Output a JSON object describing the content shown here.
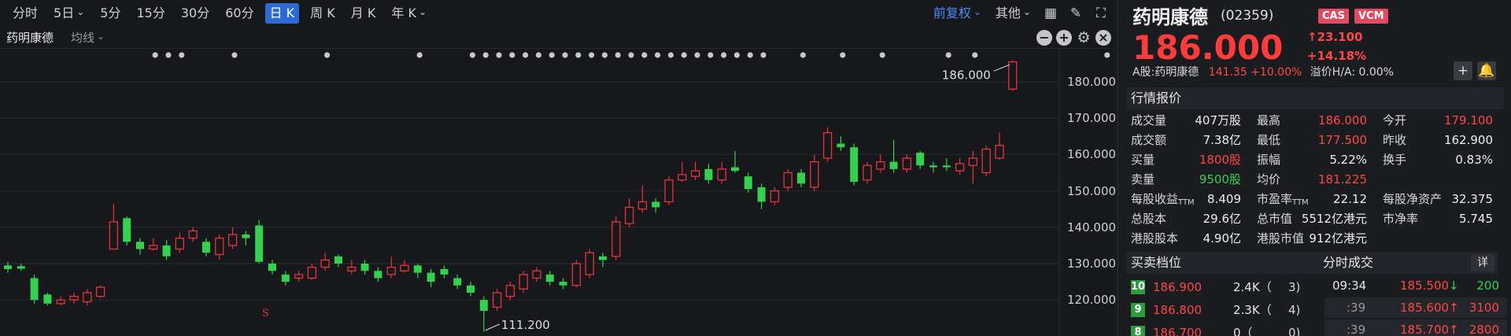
{
  "toolbar": {
    "periods": [
      "分时",
      "5日",
      "5分",
      "15分",
      "30分",
      "60分",
      "日 K",
      "周 K",
      "月 K",
      "年 K"
    ],
    "active_period": "日 K",
    "adjust": "前复权",
    "more": "其他"
  },
  "subbar": {
    "stock": "药明康德",
    "ma": "均线"
  },
  "chart_data": {
    "type": "candlestick",
    "ytick_labels": [
      "180.000",
      "170.000",
      "160.000",
      "150.000",
      "140.000",
      "130.000",
      "120.000"
    ],
    "ylim": [
      111,
      189
    ],
    "annotation_high": "186.000",
    "annotation_low": "111.200",
    "marker_s": "S",
    "candles": [
      {
        "o": 129.5,
        "c": 128.5,
        "h": 130.5,
        "l": 127.5
      },
      {
        "o": 129.3,
        "c": 128.6,
        "h": 130,
        "l": 128
      },
      {
        "o": 126,
        "c": 120,
        "h": 127,
        "l": 119
      },
      {
        "o": 121.5,
        "c": 119,
        "h": 122,
        "l": 118.5
      },
      {
        "o": 119,
        "c": 120,
        "h": 121,
        "l": 118.5
      },
      {
        "o": 120,
        "c": 121,
        "h": 122,
        "l": 119
      },
      {
        "o": 119.5,
        "c": 122,
        "h": 123,
        "l": 118.5
      },
      {
        "o": 121,
        "c": 123.5,
        "h": 124,
        "l": 120.5
      },
      {
        "o": 134,
        "c": 141.5,
        "h": 146.5,
        "l": 134
      },
      {
        "o": 142.5,
        "c": 136,
        "h": 143,
        "l": 135
      },
      {
        "o": 136,
        "c": 134,
        "h": 137,
        "l": 132.5
      },
      {
        "o": 134,
        "c": 135,
        "h": 137,
        "l": 133.5
      },
      {
        "o": 135,
        "c": 132,
        "h": 136.5,
        "l": 131
      },
      {
        "o": 134,
        "c": 137,
        "h": 138.5,
        "l": 133
      },
      {
        "o": 137,
        "c": 139,
        "h": 140,
        "l": 136
      },
      {
        "o": 136,
        "c": 133,
        "h": 137,
        "l": 132
      },
      {
        "o": 132.5,
        "c": 137,
        "h": 138,
        "l": 131
      },
      {
        "o": 135,
        "c": 138,
        "h": 140,
        "l": 134
      },
      {
        "o": 138,
        "c": 137,
        "h": 139,
        "l": 135
      },
      {
        "o": 140.5,
        "c": 130.5,
        "h": 142,
        "l": 130
      },
      {
        "o": 130,
        "c": 128,
        "h": 131,
        "l": 127
      },
      {
        "o": 127,
        "c": 125,
        "h": 128,
        "l": 124
      },
      {
        "o": 126,
        "c": 127,
        "h": 128,
        "l": 125
      },
      {
        "o": 126,
        "c": 129,
        "h": 130,
        "l": 125.5
      },
      {
        "o": 129,
        "c": 131,
        "h": 133,
        "l": 128
      },
      {
        "o": 132,
        "c": 130,
        "h": 132.5,
        "l": 129
      },
      {
        "o": 128,
        "c": 129,
        "h": 131,
        "l": 127
      },
      {
        "o": 130,
        "c": 128,
        "h": 131,
        "l": 127
      },
      {
        "o": 128,
        "c": 126,
        "h": 129,
        "l": 125
      },
      {
        "o": 127,
        "c": 129,
        "h": 132,
        "l": 126
      },
      {
        "o": 128,
        "c": 129.5,
        "h": 131,
        "l": 127.5
      },
      {
        "o": 129.5,
        "c": 127.5,
        "h": 130,
        "l": 126
      },
      {
        "o": 127.5,
        "c": 125,
        "h": 128.5,
        "l": 123.5
      },
      {
        "o": 128.5,
        "c": 127,
        "h": 129.5,
        "l": 126
      },
      {
        "o": 126,
        "c": 124,
        "h": 127,
        "l": 123
      },
      {
        "o": 124,
        "c": 122,
        "h": 125,
        "l": 121
      },
      {
        "o": 120,
        "c": 117,
        "h": 121,
        "l": 111.2
      },
      {
        "o": 118,
        "c": 122,
        "h": 123,
        "l": 117
      },
      {
        "o": 121,
        "c": 124,
        "h": 125,
        "l": 120
      },
      {
        "o": 123,
        "c": 127,
        "h": 128,
        "l": 122
      },
      {
        "o": 126,
        "c": 128,
        "h": 129,
        "l": 125
      },
      {
        "o": 127,
        "c": 125,
        "h": 128,
        "l": 124
      },
      {
        "o": 125,
        "c": 124,
        "h": 126,
        "l": 123
      },
      {
        "o": 124,
        "c": 130,
        "h": 131,
        "l": 123.5
      },
      {
        "o": 127,
        "c": 133,
        "h": 134,
        "l": 126
      },
      {
        "o": 132,
        "c": 131,
        "h": 133,
        "l": 129
      },
      {
        "o": 132,
        "c": 141.5,
        "h": 143,
        "l": 131
      },
      {
        "o": 141,
        "c": 145.5,
        "h": 148,
        "l": 140
      },
      {
        "o": 145,
        "c": 147,
        "h": 151.5,
        "l": 144
      },
      {
        "o": 147,
        "c": 145.5,
        "h": 148,
        "l": 144
      },
      {
        "o": 147,
        "c": 153,
        "h": 154,
        "l": 146
      },
      {
        "o": 153,
        "c": 154.5,
        "h": 158,
        "l": 152.5
      },
      {
        "o": 154,
        "c": 155.5,
        "h": 158,
        "l": 153
      },
      {
        "o": 156,
        "c": 153,
        "h": 157.5,
        "l": 152
      },
      {
        "o": 153,
        "c": 156,
        "h": 158,
        "l": 152
      },
      {
        "o": 156.5,
        "c": 155.5,
        "h": 161,
        "l": 155
      },
      {
        "o": 154,
        "c": 150.5,
        "h": 155,
        "l": 149.5
      },
      {
        "o": 151,
        "c": 147,
        "h": 152,
        "l": 145
      },
      {
        "o": 147,
        "c": 150,
        "h": 151,
        "l": 146
      },
      {
        "o": 151,
        "c": 155,
        "h": 156,
        "l": 150
      },
      {
        "o": 155,
        "c": 152,
        "h": 156,
        "l": 151
      },
      {
        "o": 151,
        "c": 158,
        "h": 160,
        "l": 150
      },
      {
        "o": 159,
        "c": 166,
        "h": 167.5,
        "l": 158
      },
      {
        "o": 163,
        "c": 162,
        "h": 165,
        "l": 161
      },
      {
        "o": 162,
        "c": 152.5,
        "h": 163,
        "l": 151.5
      },
      {
        "o": 153,
        "c": 157,
        "h": 158,
        "l": 152
      },
      {
        "o": 156,
        "c": 158,
        "h": 160,
        "l": 155
      },
      {
        "o": 158,
        "c": 156,
        "h": 164,
        "l": 155
      },
      {
        "o": 156,
        "c": 159,
        "h": 160,
        "l": 155
      },
      {
        "o": 160.5,
        "c": 157,
        "h": 161,
        "l": 156
      },
      {
        "o": 157,
        "c": 156.5,
        "h": 158,
        "l": 155
      },
      {
        "o": 157,
        "c": 156.5,
        "h": 159,
        "l": 155.5
      },
      {
        "o": 155.5,
        "c": 157.5,
        "h": 159,
        "l": 154.5
      },
      {
        "o": 157,
        "c": 159,
        "h": 161,
        "l": 152
      },
      {
        "o": 155,
        "c": 161.5,
        "h": 162.5,
        "l": 154
      },
      {
        "o": 159,
        "c": 162.5,
        "h": 166,
        "l": 158.5
      },
      {
        "o": 178,
        "c": 185.5,
        "h": 186,
        "l": 177.5
      }
    ],
    "marker_dot_indices": [
      4,
      5,
      6,
      10,
      17,
      24,
      28,
      29,
      30,
      31,
      32,
      33,
      34,
      35,
      36,
      37,
      38,
      39,
      40,
      41,
      42,
      43,
      44,
      45,
      46,
      47,
      48,
      49,
      50,
      53,
      56,
      59,
      64,
      66,
      76
    ]
  },
  "quote": {
    "name": "药明康德",
    "code": "(02359)",
    "badges": [
      "CAS",
      "VCM"
    ],
    "price": "186.000",
    "change": "↑23.100",
    "change_pct": "+14.18%",
    "ashare_label": "A股:药明康德",
    "ashare_price": "141.35 +10.00%",
    "premium": "溢价H/A: 0.00%",
    "section_title": "行情报价",
    "rows": [
      [
        {
          "l": "成交量",
          "v": "407万股",
          "c": ""
        },
        {
          "l": "最高",
          "v": "186.000",
          "c": "red"
        },
        {
          "l": "今开",
          "v": "179.100",
          "c": "red"
        }
      ],
      [
        {
          "l": "成交额",
          "v": "7.38亿",
          "c": ""
        },
        {
          "l": "最低",
          "v": "177.500",
          "c": "red"
        },
        {
          "l": "昨收",
          "v": "162.900",
          "c": ""
        }
      ],
      [
        {
          "l": "买量",
          "v": "1800股",
          "c": "red"
        },
        {
          "l": "振幅",
          "v": "5.22%",
          "c": ""
        },
        {
          "l": "换手",
          "v": "0.83%",
          "c": ""
        }
      ],
      [
        {
          "l": "卖量",
          "v": "9500股",
          "c": "green"
        },
        {
          "l": "均价",
          "v": "181.225",
          "c": "red"
        },
        {
          "l": "",
          "v": "",
          "c": ""
        }
      ],
      [
        {
          "l": "每股收益",
          "sub": "TTM",
          "v": "8.409",
          "c": ""
        },
        {
          "l": "市盈率",
          "sub": "TTM",
          "v": "22.12",
          "c": ""
        },
        {
          "l": "每股净资产",
          "v": "32.375",
          "c": ""
        }
      ],
      [
        {
          "l": "总股本",
          "v": "29.6亿",
          "c": ""
        },
        {
          "l": "总市值",
          "v": "5512亿港元",
          "c": ""
        },
        {
          "l": "市净率",
          "v": "5.745",
          "c": ""
        }
      ],
      [
        {
          "l": "港股股本",
          "v": "4.90亿",
          "c": ""
        },
        {
          "l": "港股市值",
          "v": "912亿港元",
          "c": ""
        },
        {
          "l": "",
          "v": "",
          "c": ""
        }
      ]
    ],
    "book_title": "买卖档位",
    "trades_title": "分时成交",
    "trades_more": "详",
    "book": [
      {
        "level": "10",
        "price": "186.900",
        "vol": "2.4K（",
        "n": "3)"
      },
      {
        "level": "9",
        "price": "186.800",
        "vol": "2.3K（",
        "n": "4)"
      },
      {
        "level": "8",
        "price": "186.700",
        "vol": "0（",
        "n": "0)"
      }
    ],
    "trades": [
      {
        "time": "09:34",
        "price": "185.500",
        "dir": "↓",
        "vol": "200",
        "pc": "red",
        "vc": "green"
      },
      {
        "time": ":39",
        "price": "185.600",
        "dir": "↑",
        "vol": "3100",
        "pc": "red",
        "vc": "red"
      },
      {
        "time": ":39",
        "price": "185.700",
        "dir": "↑",
        "vol": "2800",
        "pc": "red",
        "vc": "red"
      }
    ]
  }
}
